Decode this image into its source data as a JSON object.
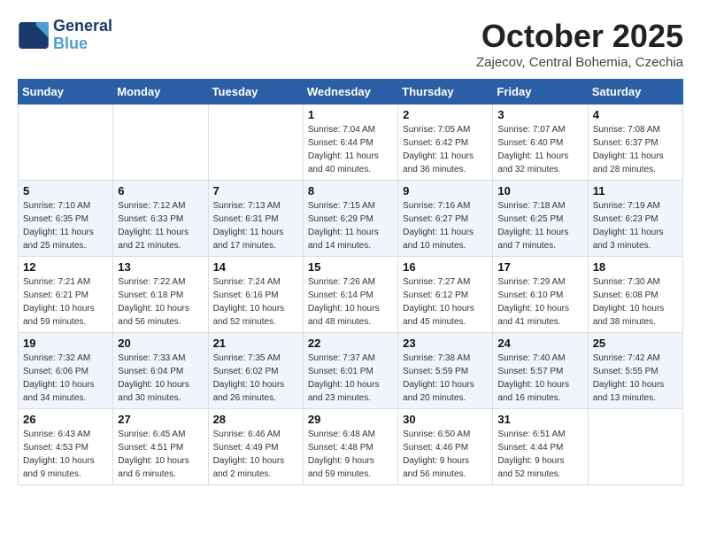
{
  "logo": {
    "line1": "General",
    "line2": "Blue"
  },
  "title": "October 2025",
  "subtitle": "Zajecov, Central Bohemia, Czechia",
  "weekdays": [
    "Sunday",
    "Monday",
    "Tuesday",
    "Wednesday",
    "Thursday",
    "Friday",
    "Saturday"
  ],
  "weeks": [
    [
      {
        "day": "",
        "info": ""
      },
      {
        "day": "",
        "info": ""
      },
      {
        "day": "",
        "info": ""
      },
      {
        "day": "1",
        "info": "Sunrise: 7:04 AM\nSunset: 6:44 PM\nDaylight: 11 hours\nand 40 minutes."
      },
      {
        "day": "2",
        "info": "Sunrise: 7:05 AM\nSunset: 6:42 PM\nDaylight: 11 hours\nand 36 minutes."
      },
      {
        "day": "3",
        "info": "Sunrise: 7:07 AM\nSunset: 6:40 PM\nDaylight: 11 hours\nand 32 minutes."
      },
      {
        "day": "4",
        "info": "Sunrise: 7:08 AM\nSunset: 6:37 PM\nDaylight: 11 hours\nand 28 minutes."
      }
    ],
    [
      {
        "day": "5",
        "info": "Sunrise: 7:10 AM\nSunset: 6:35 PM\nDaylight: 11 hours\nand 25 minutes."
      },
      {
        "day": "6",
        "info": "Sunrise: 7:12 AM\nSunset: 6:33 PM\nDaylight: 11 hours\nand 21 minutes."
      },
      {
        "day": "7",
        "info": "Sunrise: 7:13 AM\nSunset: 6:31 PM\nDaylight: 11 hours\nand 17 minutes."
      },
      {
        "day": "8",
        "info": "Sunrise: 7:15 AM\nSunset: 6:29 PM\nDaylight: 11 hours\nand 14 minutes."
      },
      {
        "day": "9",
        "info": "Sunrise: 7:16 AM\nSunset: 6:27 PM\nDaylight: 11 hours\nand 10 minutes."
      },
      {
        "day": "10",
        "info": "Sunrise: 7:18 AM\nSunset: 6:25 PM\nDaylight: 11 hours\nand 7 minutes."
      },
      {
        "day": "11",
        "info": "Sunrise: 7:19 AM\nSunset: 6:23 PM\nDaylight: 11 hours\nand 3 minutes."
      }
    ],
    [
      {
        "day": "12",
        "info": "Sunrise: 7:21 AM\nSunset: 6:21 PM\nDaylight: 10 hours\nand 59 minutes."
      },
      {
        "day": "13",
        "info": "Sunrise: 7:22 AM\nSunset: 6:18 PM\nDaylight: 10 hours\nand 56 minutes."
      },
      {
        "day": "14",
        "info": "Sunrise: 7:24 AM\nSunset: 6:16 PM\nDaylight: 10 hours\nand 52 minutes."
      },
      {
        "day": "15",
        "info": "Sunrise: 7:26 AM\nSunset: 6:14 PM\nDaylight: 10 hours\nand 48 minutes."
      },
      {
        "day": "16",
        "info": "Sunrise: 7:27 AM\nSunset: 6:12 PM\nDaylight: 10 hours\nand 45 minutes."
      },
      {
        "day": "17",
        "info": "Sunrise: 7:29 AM\nSunset: 6:10 PM\nDaylight: 10 hours\nand 41 minutes."
      },
      {
        "day": "18",
        "info": "Sunrise: 7:30 AM\nSunset: 6:08 PM\nDaylight: 10 hours\nand 38 minutes."
      }
    ],
    [
      {
        "day": "19",
        "info": "Sunrise: 7:32 AM\nSunset: 6:06 PM\nDaylight: 10 hours\nand 34 minutes."
      },
      {
        "day": "20",
        "info": "Sunrise: 7:33 AM\nSunset: 6:04 PM\nDaylight: 10 hours\nand 30 minutes."
      },
      {
        "day": "21",
        "info": "Sunrise: 7:35 AM\nSunset: 6:02 PM\nDaylight: 10 hours\nand 26 minutes."
      },
      {
        "day": "22",
        "info": "Sunrise: 7:37 AM\nSunset: 6:01 PM\nDaylight: 10 hours\nand 23 minutes."
      },
      {
        "day": "23",
        "info": "Sunrise: 7:38 AM\nSunset: 5:59 PM\nDaylight: 10 hours\nand 20 minutes."
      },
      {
        "day": "24",
        "info": "Sunrise: 7:40 AM\nSunset: 5:57 PM\nDaylight: 10 hours\nand 16 minutes."
      },
      {
        "day": "25",
        "info": "Sunrise: 7:42 AM\nSunset: 5:55 PM\nDaylight: 10 hours\nand 13 minutes."
      }
    ],
    [
      {
        "day": "26",
        "info": "Sunrise: 6:43 AM\nSunset: 4:53 PM\nDaylight: 10 hours\nand 9 minutes."
      },
      {
        "day": "27",
        "info": "Sunrise: 6:45 AM\nSunset: 4:51 PM\nDaylight: 10 hours\nand 6 minutes."
      },
      {
        "day": "28",
        "info": "Sunrise: 6:46 AM\nSunset: 4:49 PM\nDaylight: 10 hours\nand 2 minutes."
      },
      {
        "day": "29",
        "info": "Sunrise: 6:48 AM\nSunset: 4:48 PM\nDaylight: 9 hours\nand 59 minutes."
      },
      {
        "day": "30",
        "info": "Sunrise: 6:50 AM\nSunset: 4:46 PM\nDaylight: 9 hours\nand 56 minutes."
      },
      {
        "day": "31",
        "info": "Sunrise: 6:51 AM\nSunset: 4:44 PM\nDaylight: 9 hours\nand 52 minutes."
      },
      {
        "day": "",
        "info": ""
      }
    ]
  ]
}
